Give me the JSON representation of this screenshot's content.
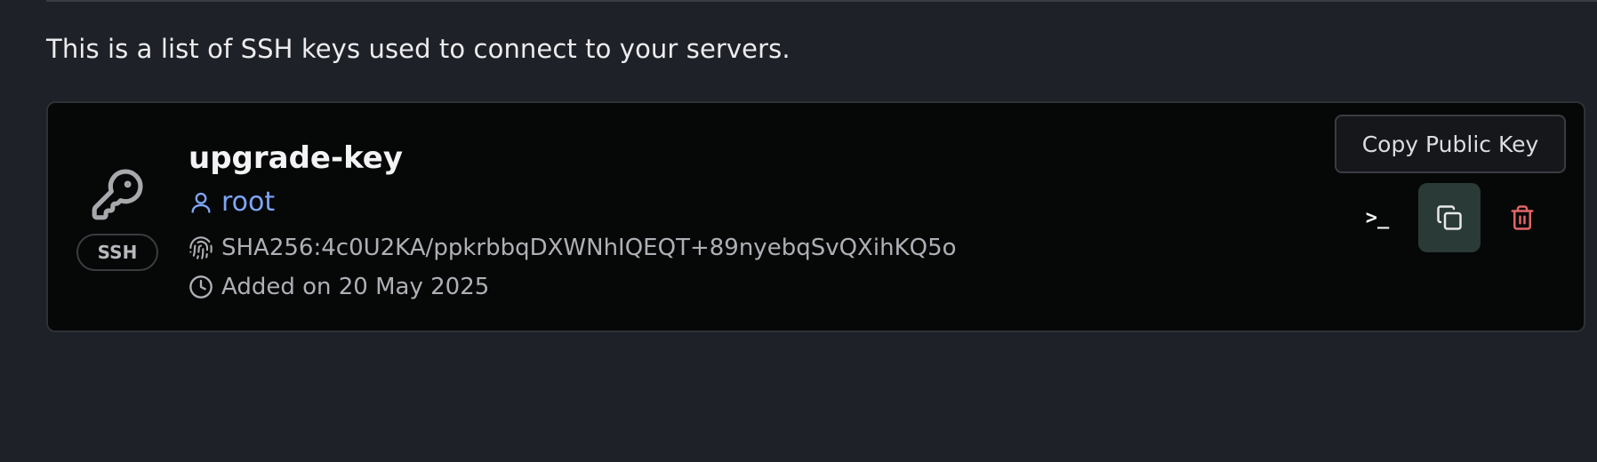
{
  "description": "This is a list of SSH keys used to connect to your servers.",
  "key": {
    "name": "upgrade-key",
    "type_badge": "SSH",
    "user": "root",
    "fingerprint": "SHA256:4c0U2KA/ppkrbbqDXWNhIQEQT+89nyebqSvQXihKQ5o",
    "added": "Added on 20 May 2025"
  },
  "actions": {
    "tooltip": "Copy Public Key",
    "terminal_glyph": ">_"
  },
  "icons": {
    "key": "key-icon",
    "user": "user-icon",
    "fingerprint": "fingerprint-icon",
    "clock": "clock-icon",
    "terminal": "terminal-icon",
    "copy": "copy-icon",
    "trash": "trash-icon"
  },
  "colors": {
    "background": "#1f2128",
    "card": "#060707",
    "user_accent": "#7ea6f5",
    "delete": "#e06666",
    "copy_button_bg": "#2a3a36"
  }
}
